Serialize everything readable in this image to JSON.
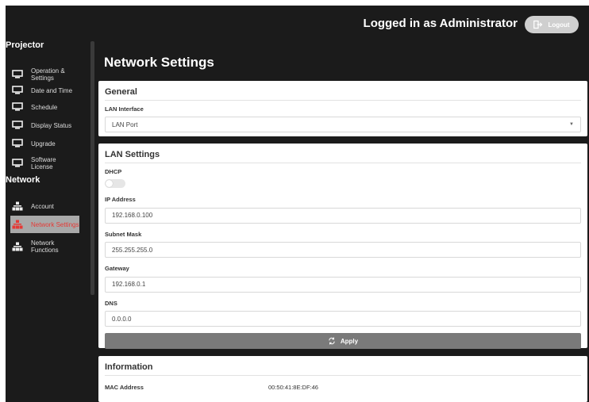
{
  "header": {
    "logged_in_text": "Logged in as Administrator",
    "logout_label": "Logout"
  },
  "sidebar": {
    "projector_title": "Projector",
    "network_title": "Network",
    "projector_items": [
      {
        "label": "Operation & Settings",
        "icon": "monitor-icon"
      },
      {
        "label": "Date and Time",
        "icon": "monitor-icon"
      },
      {
        "label": "Schedule",
        "icon": "monitor-icon"
      },
      {
        "label": "Display Status",
        "icon": "monitor-icon"
      },
      {
        "label": "Upgrade",
        "icon": "monitor-icon"
      },
      {
        "label": "Software License",
        "icon": "monitor-icon"
      }
    ],
    "network_items": [
      {
        "label": "Account",
        "icon": "network-icon",
        "active": false
      },
      {
        "label": "Network Settings",
        "icon": "network-icon",
        "active": true
      },
      {
        "label": "Network Functions",
        "icon": "network-icon",
        "active": false
      }
    ]
  },
  "main": {
    "title": "Network Settings",
    "general": {
      "title": "General",
      "lan_interface_label": "LAN Interface",
      "lan_interface_value": "LAN Port"
    },
    "lan_settings": {
      "title": "LAN Settings",
      "dhcp_label": "DHCP",
      "dhcp_enabled": false,
      "ip_label": "IP Address",
      "ip_value": "192.168.0.100",
      "subnet_label": "Subnet Mask",
      "subnet_value": "255.255.255.0",
      "gateway_label": "Gateway",
      "gateway_value": "192.168.0.1",
      "dns_label": "DNS",
      "dns_value": "0.0.0.0",
      "apply_label": "Apply"
    },
    "information": {
      "title": "Information",
      "mac_label": "MAC Address",
      "mac_value": "00:50:41:8E:DF:46"
    }
  },
  "colors": {
    "background": "#1b1b1b",
    "active_item_bg": "#a9a9a9",
    "active_item_text": "#e53935",
    "apply_button": "#7a7a7a"
  }
}
